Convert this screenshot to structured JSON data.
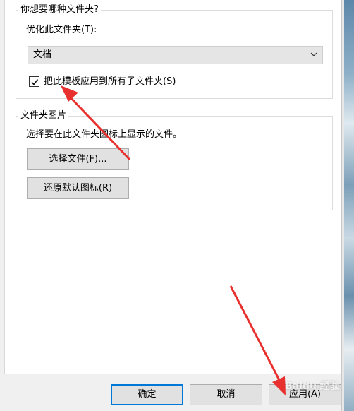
{
  "optimize_group": {
    "title": "你想要哪种文件夹?",
    "optimize_label": "优化此文件夹(T):",
    "template_value": "文档",
    "apply_subfolders_label": "把此模板应用到所有子文件夹(S)",
    "apply_subfolders_checked": true
  },
  "picture_group": {
    "title": "文件夹图片",
    "description": "选择要在此文件夹图标上显示的文件。",
    "choose_file_button": "选择文件(F)...",
    "restore_icon_button": "还原默认图标(R)"
  },
  "footer": {
    "ok_button": "确定",
    "cancel_button": "取消",
    "apply_button": "应用(A)"
  },
  "annotations": {
    "arrow_color": "#e8312f",
    "watermark": "Baidu 经验"
  },
  "icons": [
    "chevron-down-icon",
    "checkmark-icon",
    "red-arrow-icon"
  ]
}
